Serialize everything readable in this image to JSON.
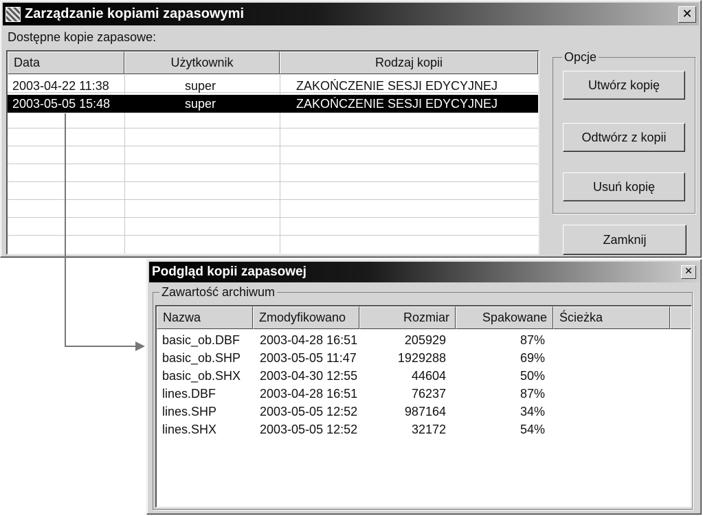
{
  "main_window": {
    "title": "Zarządzanie kopiami zapasowymi",
    "close_glyph": "✕",
    "available_label": "Dostępne kopie zapasowe:",
    "columns": [
      "Data",
      "Użytkownik",
      "Rodzaj kopii"
    ],
    "rows": [
      {
        "date": "2003-04-22 11:38",
        "user": "super",
        "type": "ZAKOŃCZENIE SESJI EDYCYJNEJ",
        "selected": false
      },
      {
        "date": "2003-05-05 15:48",
        "user": "super",
        "type": "ZAKOŃCZENIE SESJI EDYCYJNEJ",
        "selected": true
      }
    ],
    "options_group": {
      "legend": "Opcje",
      "create_button": "Utwórz kopię",
      "restore_button": "Odtwórz z kopii",
      "delete_button": "Usuń kopię"
    },
    "close_button": "Zamknij"
  },
  "preview_window": {
    "title": "Podgląd kopii zapasowej",
    "close_glyph": "✕",
    "archive_group_legend": "Zawartość archiwum",
    "columns": [
      "Nazwa",
      "Zmodyfikowano",
      "Rozmiar",
      "Spakowane",
      "Ścieżka"
    ],
    "files": [
      {
        "name": "basic_ob.DBF",
        "modified": "2003-04-28 16:51",
        "size": "205929",
        "packed": "87%",
        "path": ""
      },
      {
        "name": "basic_ob.SHP",
        "modified": "2003-05-05 11:47",
        "size": "1929288",
        "packed": "69%",
        "path": ""
      },
      {
        "name": "basic_ob.SHX",
        "modified": "2003-04-30 12:55",
        "size": "44604",
        "packed": "50%",
        "path": ""
      },
      {
        "name": "lines.DBF",
        "modified": "2003-04-28 16:51",
        "size": "76237",
        "packed": "87%",
        "path": ""
      },
      {
        "name": "lines.SHP",
        "modified": "2003-05-05 12:52",
        "size": "987164",
        "packed": "34%",
        "path": ""
      },
      {
        "name": "lines.SHX",
        "modified": "2003-05-05 12:52",
        "size": "32172",
        "packed": "54%",
        "path": ""
      }
    ]
  },
  "icons": {
    "app_icon": "backup-app-icon",
    "close_icon": "close-icon",
    "connector": "arrow-right-icon"
  },
  "colors": {
    "window_face": "#d4d4d4",
    "title_start": "#000000",
    "title_end": "#b8b8b8",
    "selection": "#000000",
    "selection_text": "#ffffff"
  }
}
